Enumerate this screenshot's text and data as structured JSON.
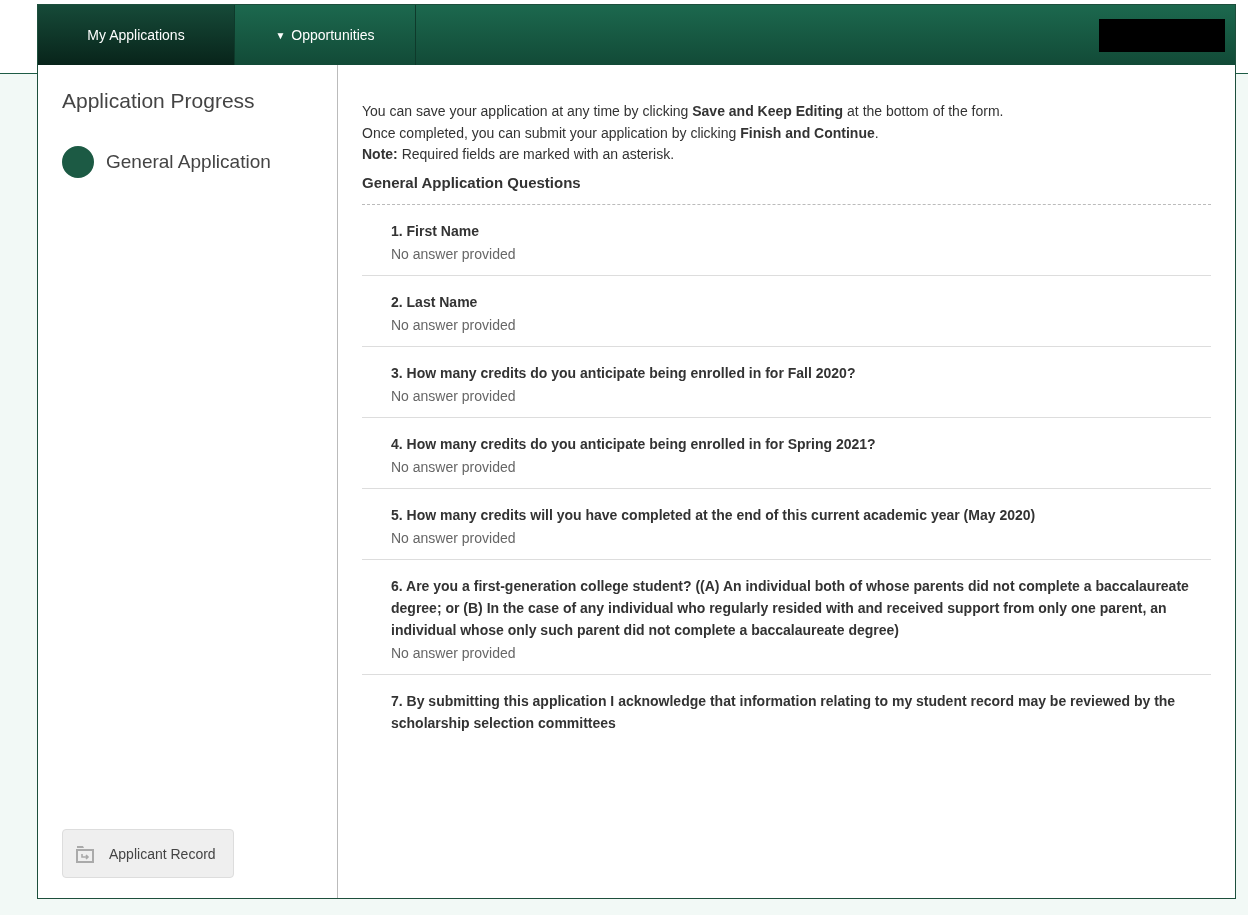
{
  "nav": {
    "tabs": [
      {
        "label": "My Applications",
        "selected": true
      },
      {
        "label": "Opportunities",
        "caret": "▼",
        "selected": false
      }
    ]
  },
  "sidebar": {
    "title": "Application Progress",
    "steps": [
      {
        "label": "General Application",
        "selected": true
      }
    ],
    "record_button": "Applicant Record"
  },
  "intro": [
    "You can save your application at any time by clicking **Save and Keep Editing** at the bottom of the form.",
    "Once completed, you can submit your application by clicking **Finish and Continue**.",
    "**Note:** Required fields are marked with an asterisk."
  ],
  "section_title": "General Application Questions",
  "questions": [
    {
      "question": "1. First Name",
      "answer": "No answer provided"
    },
    {
      "question": "2. Last Name",
      "answer": "No answer provided"
    },
    {
      "question": "3. How many credits do you anticipate being enrolled in for Fall 2020?",
      "answer": "No answer provided"
    },
    {
      "question": "4. How many credits do you anticipate being enrolled in for Spring 2021?",
      "answer": "No answer provided"
    },
    {
      "question": "5. How many credits will you have completed at the end of this current academic year (May 2020)",
      "answer": "No answer provided"
    },
    {
      "question": "6. Are you a first-generation college student? ((A) An individual both of whose parents did not complete a baccalaureate degree; or (B) In the case of any individual who regularly resided with and received support from only one parent, an individual whose only such parent did not complete a baccalaureate degree)",
      "answer": "No answer provided"
    },
    {
      "question": "7. By submitting this application I acknowledge that information relating to my student record may be reviewed by the scholarship selection committees"
    }
  ]
}
